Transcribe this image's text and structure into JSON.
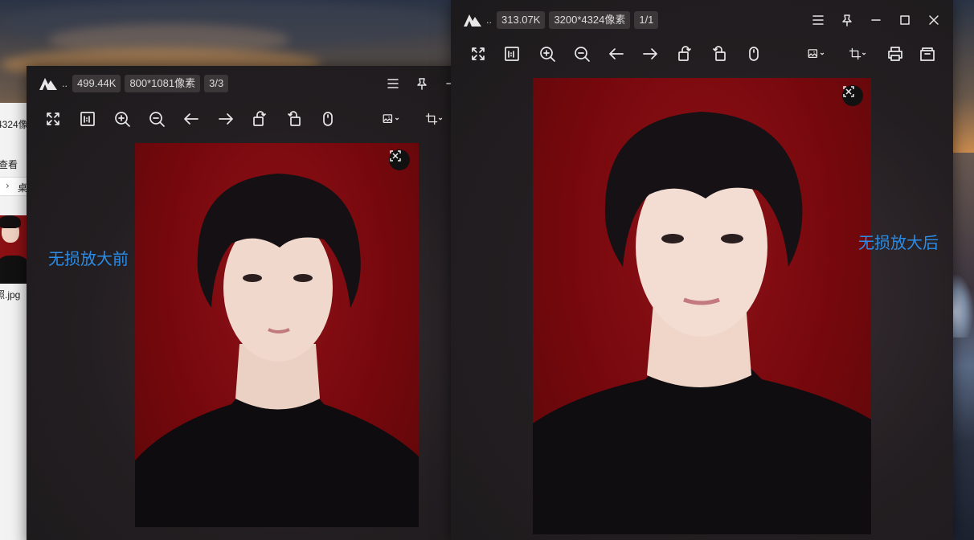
{
  "desktop": {
    "explorer_rows": [
      "4324像",
      "查看",
      "桌",
      "照.jpg"
    ]
  },
  "viewer_before": {
    "app_ellipsis": "..",
    "file_size": "499.44K",
    "resolution": "800*1081像素",
    "page_index": "3/3",
    "caption": "无损放大前"
  },
  "viewer_after": {
    "app_ellipsis": "..",
    "file_size": "313.07K",
    "resolution": "3200*4324像素",
    "page_index": "1/1",
    "caption": "无损放大后"
  },
  "colors": {
    "caption": "#2a8de8",
    "window_bg": "#221d20",
    "chip_bg": "#3b3638",
    "photo_red": "#7a0a10"
  },
  "icons": {
    "toolbar": [
      "fullscreen-icon",
      "actual-size-icon",
      "zoom-in-icon",
      "zoom-out-icon",
      "arrow-left-icon",
      "arrow-right-icon",
      "rotate-left-icon",
      "rotate-right-icon",
      "mouse-icon",
      "image-edit-icon",
      "crop-icon",
      "print-icon",
      "open-folder-icon"
    ],
    "titlebar": [
      "menu-icon",
      "pin-icon",
      "minimize-icon",
      "maximize-icon",
      "close-icon"
    ]
  }
}
